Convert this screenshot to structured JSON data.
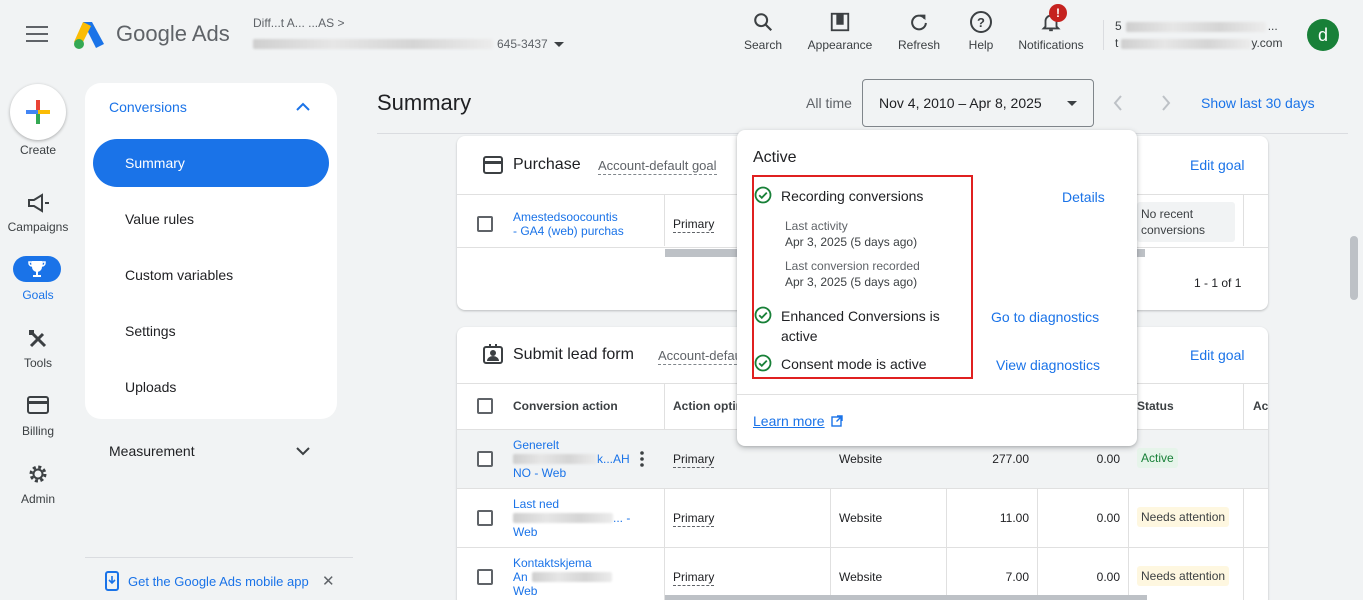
{
  "app": {
    "name": "Google Ads",
    "account_line1": "Diff...t A... ...AS  >",
    "account_line2_tail": "645-3437"
  },
  "toolbar": {
    "search": "Search",
    "appearance": "Appearance",
    "refresh": "Refresh",
    "help": "Help",
    "notifications": "Notifications",
    "notifications_badge": "!"
  },
  "user": {
    "line1_head": "5",
    "line1_tail": "...",
    "line2_head": "t",
    "line2_tail": "y.com",
    "avatar_letter": "d"
  },
  "rail": {
    "create": "Create",
    "campaigns": "Campaigns",
    "goals": "Goals",
    "tools": "Tools",
    "billing": "Billing",
    "admin": "Admin"
  },
  "subnav": {
    "section": "Conversions",
    "items": [
      "Summary",
      "Value rules",
      "Custom variables",
      "Settings",
      "Uploads"
    ],
    "measurement": "Measurement",
    "mobile_app": "Get the Google Ads mobile app"
  },
  "header": {
    "title": "Summary",
    "all_time": "All time",
    "date_range": "Nov 4, 2010 – Apr 8, 2025",
    "show_last": "Show last 30 days"
  },
  "purchase_card": {
    "title": "Purchase",
    "subtitle": "Account-default goal",
    "edit_goal": "Edit goal",
    "row": {
      "name_line1": "Amestedsoocountis",
      "name_line2": "- GA4 (web) purchas",
      "optimization": "Primary",
      "status": "No recent conversions"
    },
    "pagination": "1 - 1 of 1"
  },
  "lead_card": {
    "title": "Submit lead form",
    "subtitle": "Account-defau",
    "edit_goal": "Edit goal",
    "columns": {
      "action": "Conversion action",
      "optimization": "Action optim",
      "status": "Status",
      "actions": "Ac"
    },
    "rows": [
      {
        "line1": "Generelt",
        "line2": "k...AH",
        "line3": "NO - Web",
        "optimization": "Primary",
        "source": "Website",
        "conversions": "277.00",
        "value": "0.00",
        "status": "Active"
      },
      {
        "line1": "Last ned",
        "line2": "... -",
        "line3": "Web",
        "optimization": "Primary",
        "source": "Website",
        "conversions": "11.00",
        "value": "0.00",
        "status": "Needs attention"
      },
      {
        "line1": "Kontaktskjema",
        "line2": "An",
        "line3": "Web",
        "optimization": "Primary",
        "source": "Website",
        "conversions": "7.00",
        "value": "0.00",
        "status": "Needs attention"
      }
    ]
  },
  "popover": {
    "title": "Active",
    "recording": "Recording conversions",
    "details": "Details",
    "last_activity_label": "Last activity",
    "last_activity_value": "Apr 3, 2025 (5 days ago)",
    "last_conversion_label": "Last conversion recorded",
    "last_conversion_value": "Apr 3, 2025 (5 days ago)",
    "enhanced": "Enhanced Conversions is active",
    "go_diag": "Go to diagnostics",
    "consent": "Consent mode is active",
    "view_diag": "View diagnostics",
    "learn_more": "Learn more"
  },
  "colors": {
    "accent": "#1a73e8",
    "success": "#188038",
    "highlight_box": "#e02020"
  }
}
